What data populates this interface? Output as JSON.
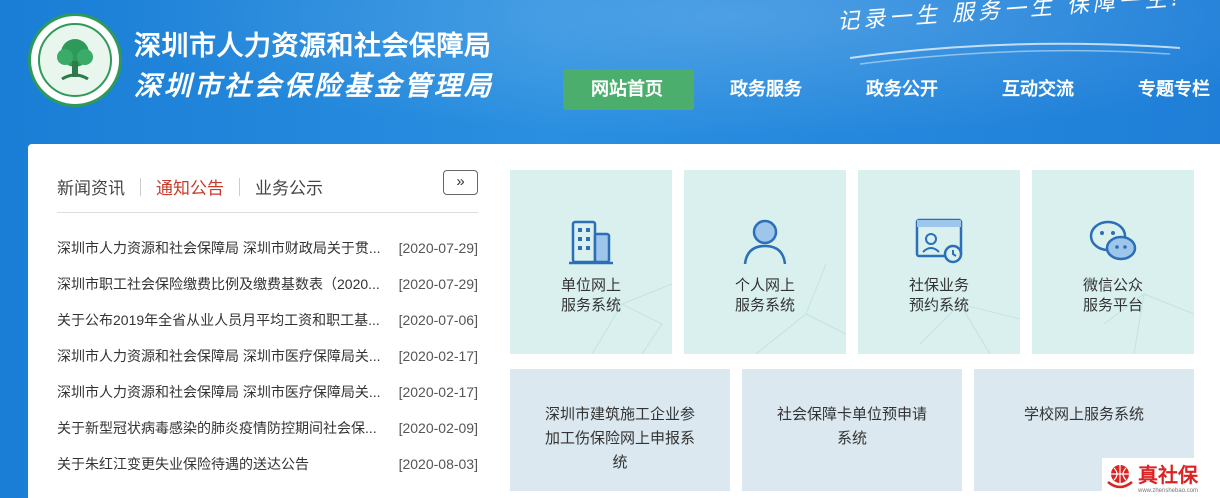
{
  "header": {
    "org_name_1": "深圳市人力资源和社会保障局",
    "org_name_2": "深圳市社会保险基金管理局",
    "slogan": "记录一生 服务一生 保障一生!",
    "logo_icon": "tree-logo-icon"
  },
  "nav": {
    "items": [
      {
        "label": "网站首页",
        "active": true
      },
      {
        "label": "政务服务"
      },
      {
        "label": "政务公开"
      },
      {
        "label": "互动交流"
      },
      {
        "label": "专题专栏"
      }
    ]
  },
  "news": {
    "tabs": [
      {
        "label": "新闻资讯"
      },
      {
        "label": "通知公告",
        "active": true
      },
      {
        "label": "业务公示"
      }
    ],
    "more_label": "»",
    "items": [
      {
        "title": "深圳市人力资源和社会保障局 深圳市财政局关于贯...",
        "date": "[2020-07-29]"
      },
      {
        "title": "深圳市职工社会保险缴费比例及缴费基数表（2020...",
        "date": "[2020-07-29]"
      },
      {
        "title": "关于公布2019年全省从业人员月平均工资和职工基...",
        "date": "[2020-07-06]"
      },
      {
        "title": "深圳市人力资源和社会保障局 深圳市医疗保障局关...",
        "date": "[2020-02-17]"
      },
      {
        "title": "深圳市人力资源和社会保障局 深圳市医疗保障局关...",
        "date": "[2020-02-17]"
      },
      {
        "title": "关于新型冠状病毒感染的肺炎疫情防控期间社会保...",
        "date": "[2020-02-09]"
      },
      {
        "title": "关于朱红江变更失业保险待遇的送达公告",
        "date": "[2020-08-03]"
      }
    ]
  },
  "services": {
    "top": [
      {
        "line1": "单位网上",
        "line2": "服务系统",
        "icon": "building-icon"
      },
      {
        "line1": "个人网上",
        "line2": "服务系统",
        "icon": "person-icon"
      },
      {
        "line1": "社保业务",
        "line2": "预约系统",
        "icon": "appointment-card-icon"
      },
      {
        "line1": "微信公众",
        "line2": "服务平台",
        "icon": "wechat-icon"
      }
    ],
    "bottom": [
      {
        "line1": "深圳市建筑施工企业参",
        "line2": "加工伤保险网上申报系",
        "line3": "统"
      },
      {
        "line1": "社会保障卡单位预申请",
        "line2": "系统"
      },
      {
        "line1": "学校网上服务系统"
      }
    ]
  },
  "watermark": {
    "text": "真社保",
    "subtext": "www.zhenshebao.com"
  },
  "colors": {
    "header_blue": "#1e83d8",
    "nav_active": "#4cae6c",
    "tab_active": "#c83a2a",
    "tile_bg": "#d9f0ef",
    "tile2_bg": "#dbe8ef",
    "icon_blue": "#2a6fb8"
  }
}
